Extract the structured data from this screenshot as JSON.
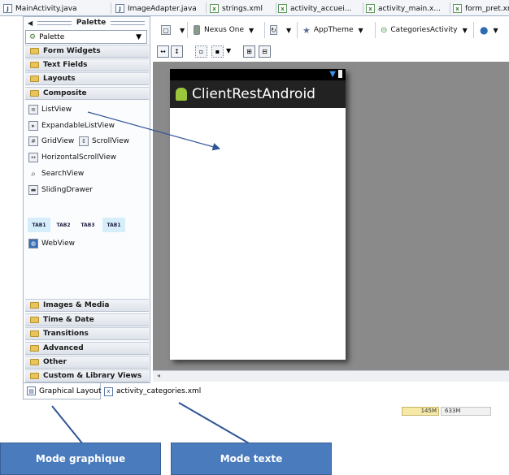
{
  "editor_tabs": [
    {
      "label": "MainActivity.java",
      "icon": "java-file-icon"
    },
    {
      "label": "ImageAdapter.java",
      "icon": "java-file-icon"
    },
    {
      "label": "strings.xml",
      "icon": "xml-file-icon"
    },
    {
      "label": "activity_accuei...",
      "icon": "xml-file-icon"
    },
    {
      "label": "activity_main.x...",
      "icon": "xml-file-icon"
    },
    {
      "label": "form_pret.xm",
      "icon": "xml-file-icon"
    }
  ],
  "palette": {
    "header": "Palette",
    "selector_value": "Palette",
    "categories_top": [
      "Form Widgets",
      "Text Fields",
      "Layouts",
      "Composite"
    ],
    "composite_items": {
      "listview": "ListView",
      "expandable": "ExpandableListView",
      "gridview": "GridView",
      "scrollview": "ScrollView",
      "hscrollview": "HorizontalScrollView",
      "searchview": "SearchView",
      "slidingdrawer": "SlidingDrawer",
      "tabs": [
        "TAB1",
        "TAB2",
        "TAB3",
        "TAB1"
      ],
      "webview": "WebView"
    },
    "categories_bottom": [
      "Images & Media",
      "Time & Date",
      "Transitions",
      "Advanced",
      "Other",
      "Custom & Library Views"
    ]
  },
  "toolbar": {
    "device": "Nexus One",
    "theme": "AppTheme",
    "activity": "CategoriesActivity"
  },
  "device_preview": {
    "app_title": "ClientRestAndroid"
  },
  "mode_tabs": [
    "Graphical Layout",
    "activity_categories.xml"
  ],
  "memory": {
    "used": "145M",
    "total": "633M"
  },
  "callouts": {
    "graphical": "Mode graphique",
    "text": "Mode texte"
  },
  "colors": {
    "callout_fill": "#4a7bbd",
    "arrow": "#2f5597",
    "canvas": "#8a8a8a",
    "action_bar": "#222222"
  }
}
